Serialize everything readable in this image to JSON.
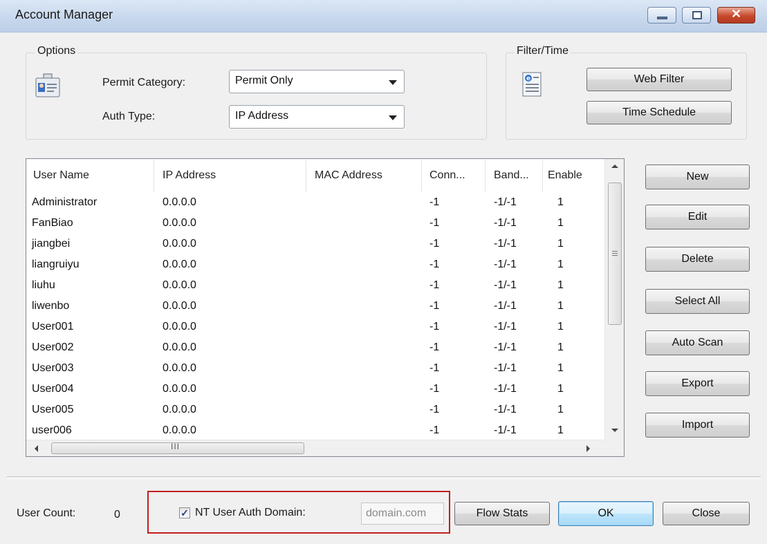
{
  "window": {
    "title": "Account Manager"
  },
  "options": {
    "group_label": "Options",
    "permit_category_label": "Permit Category:",
    "permit_category_value": "Permit Only",
    "auth_type_label": "Auth Type:",
    "auth_type_value": "IP Address"
  },
  "filter_time": {
    "group_label": "Filter/Time",
    "web_filter_label": "Web Filter",
    "time_schedule_label": "Time Schedule"
  },
  "table": {
    "columns": [
      "User Name",
      "IP Address",
      "MAC Address",
      "Conn...",
      "Band...",
      "Enable"
    ],
    "rows": [
      [
        "Administrator",
        "0.0.0.0",
        "",
        "-1",
        "-1/-1",
        "1"
      ],
      [
        "FanBiao",
        "0.0.0.0",
        "",
        "-1",
        "-1/-1",
        "1"
      ],
      [
        "jiangbei",
        "0.0.0.0",
        "",
        "-1",
        "-1/-1",
        "1"
      ],
      [
        "liangruiyu",
        "0.0.0.0",
        "",
        "-1",
        "-1/-1",
        "1"
      ],
      [
        "liuhu",
        "0.0.0.0",
        "",
        "-1",
        "-1/-1",
        "1"
      ],
      [
        "liwenbo",
        "0.0.0.0",
        "",
        "-1",
        "-1/-1",
        "1"
      ],
      [
        "User001",
        "0.0.0.0",
        "",
        "-1",
        "-1/-1",
        "1"
      ],
      [
        "User002",
        "0.0.0.0",
        "",
        "-1",
        "-1/-1",
        "1"
      ],
      [
        "User003",
        "0.0.0.0",
        "",
        "-1",
        "-1/-1",
        "1"
      ],
      [
        "User004",
        "0.0.0.0",
        "",
        "-1",
        "-1/-1",
        "1"
      ],
      [
        "User005",
        "0.0.0.0",
        "",
        "-1",
        "-1/-1",
        "1"
      ],
      [
        "user006",
        "0.0.0.0",
        "",
        "-1",
        "-1/-1",
        "1"
      ]
    ]
  },
  "side_buttons": [
    "New",
    "Edit",
    "Delete",
    "Select All",
    "Auto Scan",
    "Export",
    "Import"
  ],
  "footer": {
    "user_count_label": "User Count:",
    "user_count_value": "0",
    "nt_auth_label": "NT User Auth Domain:",
    "nt_auth_checked": true,
    "domain_placeholder": "domain.com",
    "flow_stats_label": "Flow Stats",
    "ok_label": "OK",
    "close_label": "Close"
  },
  "colors": {
    "highlight_box": "#c0201b",
    "title_bar": "#c7d7ec"
  }
}
